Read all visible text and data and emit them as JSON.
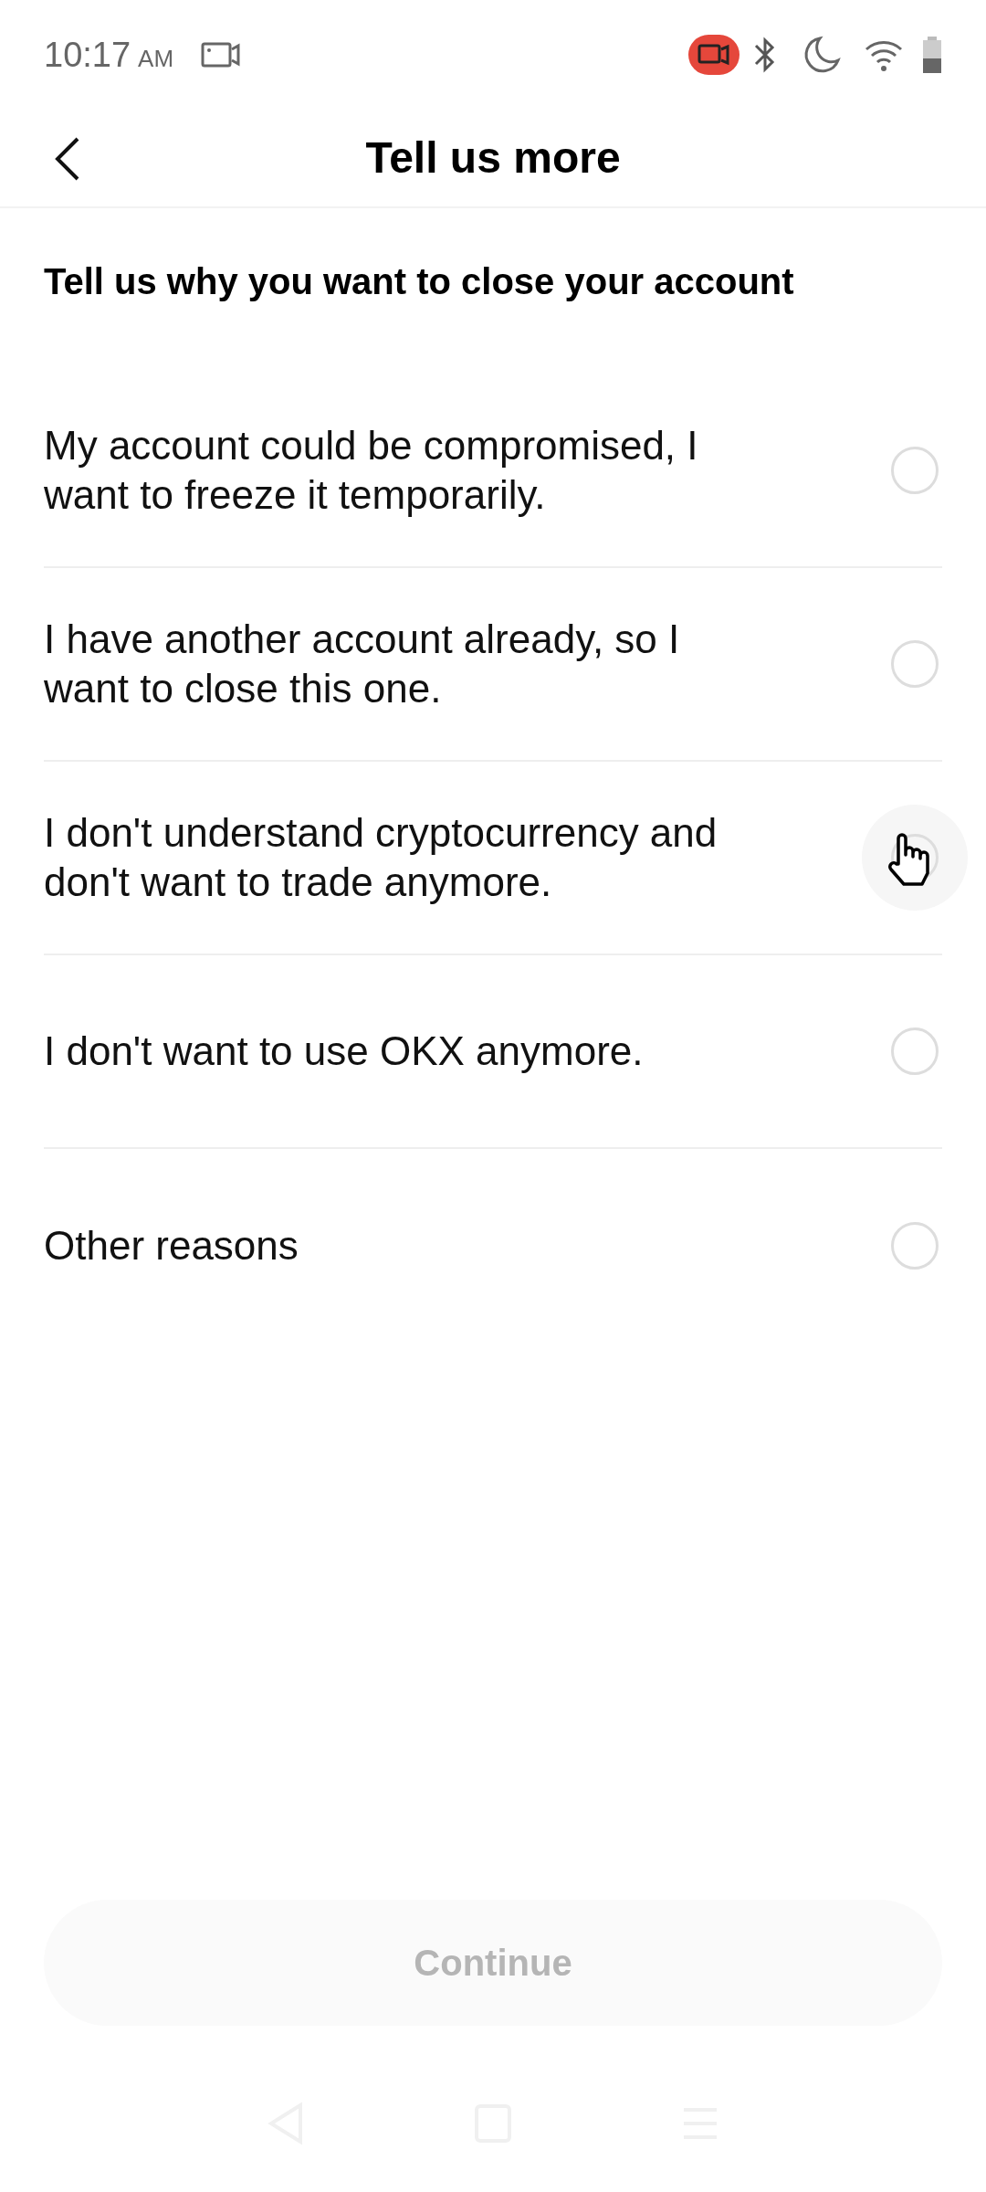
{
  "status_bar": {
    "time": "10:17",
    "period": "AM"
  },
  "header": {
    "title": "Tell us more"
  },
  "question": "Tell us why you want to close your account",
  "options": [
    {
      "label": "My account could be compromised, I want to freeze it temporarily.",
      "selected": false,
      "pressed": false
    },
    {
      "label": "I have another account already, so I want to close this one.",
      "selected": false,
      "pressed": false
    },
    {
      "label": "I don't understand cryptocurrency and don't want to trade anymore.",
      "selected": false,
      "pressed": true
    },
    {
      "label": "I don't want to use OKX anymore.",
      "selected": false,
      "pressed": false
    },
    {
      "label": "Other reasons",
      "selected": false,
      "pressed": false
    }
  ],
  "continue_button": {
    "label": "Continue",
    "disabled": true
  }
}
